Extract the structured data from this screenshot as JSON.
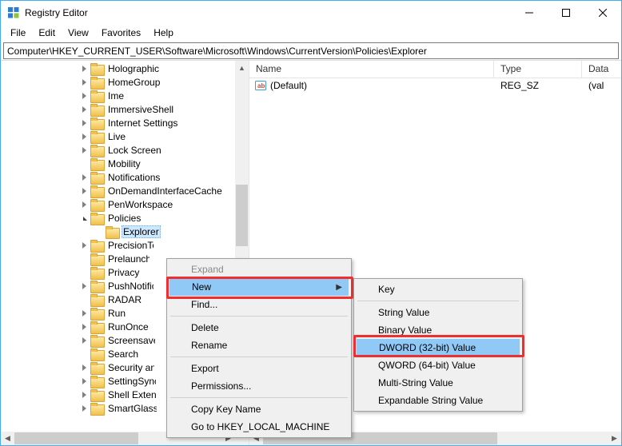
{
  "window": {
    "title": "Registry Editor"
  },
  "menubar": [
    "File",
    "Edit",
    "View",
    "Favorites",
    "Help"
  ],
  "address": "Computer\\HKEY_CURRENT_USER\\Software\\Microsoft\\Windows\\CurrentVersion\\Policies\\Explorer",
  "tree": [
    {
      "indent": 112,
      "chev": "closed",
      "label": "Holographic"
    },
    {
      "indent": 112,
      "chev": "closed",
      "label": "HomeGroup"
    },
    {
      "indent": 112,
      "chev": "closed",
      "label": "Ime"
    },
    {
      "indent": 112,
      "chev": "closed",
      "label": "ImmersiveShell"
    },
    {
      "indent": 112,
      "chev": "closed",
      "label": "Internet Settings"
    },
    {
      "indent": 112,
      "chev": "closed",
      "label": "Live"
    },
    {
      "indent": 112,
      "chev": "closed",
      "label": "Lock Screen"
    },
    {
      "indent": 112,
      "chev": "none",
      "label": "Mobility"
    },
    {
      "indent": 112,
      "chev": "closed",
      "label": "Notifications"
    },
    {
      "indent": 112,
      "chev": "closed",
      "label": "OnDemandInterfaceCache"
    },
    {
      "indent": 112,
      "chev": "closed",
      "label": "PenWorkspace"
    },
    {
      "indent": 112,
      "chev": "open",
      "label": "Policies"
    },
    {
      "indent": 131,
      "chev": "none",
      "label": "Explorer",
      "selected": true,
      "truncate": 56
    },
    {
      "indent": 112,
      "chev": "closed",
      "label": "PrecisionTouchPad",
      "truncate": 59
    },
    {
      "indent": 112,
      "chev": "none",
      "label": "PrelaunchSettings",
      "truncate": 54
    },
    {
      "indent": 112,
      "chev": "none",
      "label": "Privacy"
    },
    {
      "indent": 112,
      "chev": "closed",
      "label": "PushNotifications",
      "truncate": 59
    },
    {
      "indent": 112,
      "chev": "none",
      "label": "RADAR"
    },
    {
      "indent": 112,
      "chev": "closed",
      "label": "Run"
    },
    {
      "indent": 112,
      "chev": "closed",
      "label": "RunOnce"
    },
    {
      "indent": 112,
      "chev": "closed",
      "label": "Screensavers",
      "truncate": 61
    },
    {
      "indent": 112,
      "chev": "none",
      "label": "Search"
    },
    {
      "indent": 112,
      "chev": "closed",
      "label": "Security and Maintenance",
      "truncate": 60
    },
    {
      "indent": 112,
      "chev": "closed",
      "label": "SettingSync",
      "truncate": 62
    },
    {
      "indent": 112,
      "chev": "closed",
      "label": "Shell Extensions",
      "truncate": 62
    },
    {
      "indent": 112,
      "chev": "closed",
      "label": "SmartGlass",
      "truncate": 63
    }
  ],
  "list": {
    "columns": {
      "name": "Name",
      "type": "Type",
      "data": "Data"
    },
    "rows": [
      {
        "name": "(Default)",
        "type": "REG_SZ",
        "data": "(value not set)",
        "data_truncated": "(val"
      }
    ]
  },
  "ctx_main": {
    "expand": "Expand",
    "new": "New",
    "find": "Find...",
    "delete": "Delete",
    "rename": "Rename",
    "export": "Export",
    "permissions": "Permissions...",
    "copykey": "Copy Key Name",
    "goto": "Go to HKEY_LOCAL_MACHINE"
  },
  "ctx_new": {
    "key": "Key",
    "string": "String Value",
    "binary": "Binary Value",
    "dword": "DWORD (32-bit) Value",
    "qword": "QWORD (64-bit) Value",
    "multi": "Multi-String Value",
    "expand": "Expandable String Value"
  },
  "tree_scroll": {
    "thumb_top_pct": 32,
    "thumb_height_pct": 18
  },
  "list_hscroll": {
    "thumb_left_pct": 0,
    "thumb_width_pct": 68
  }
}
